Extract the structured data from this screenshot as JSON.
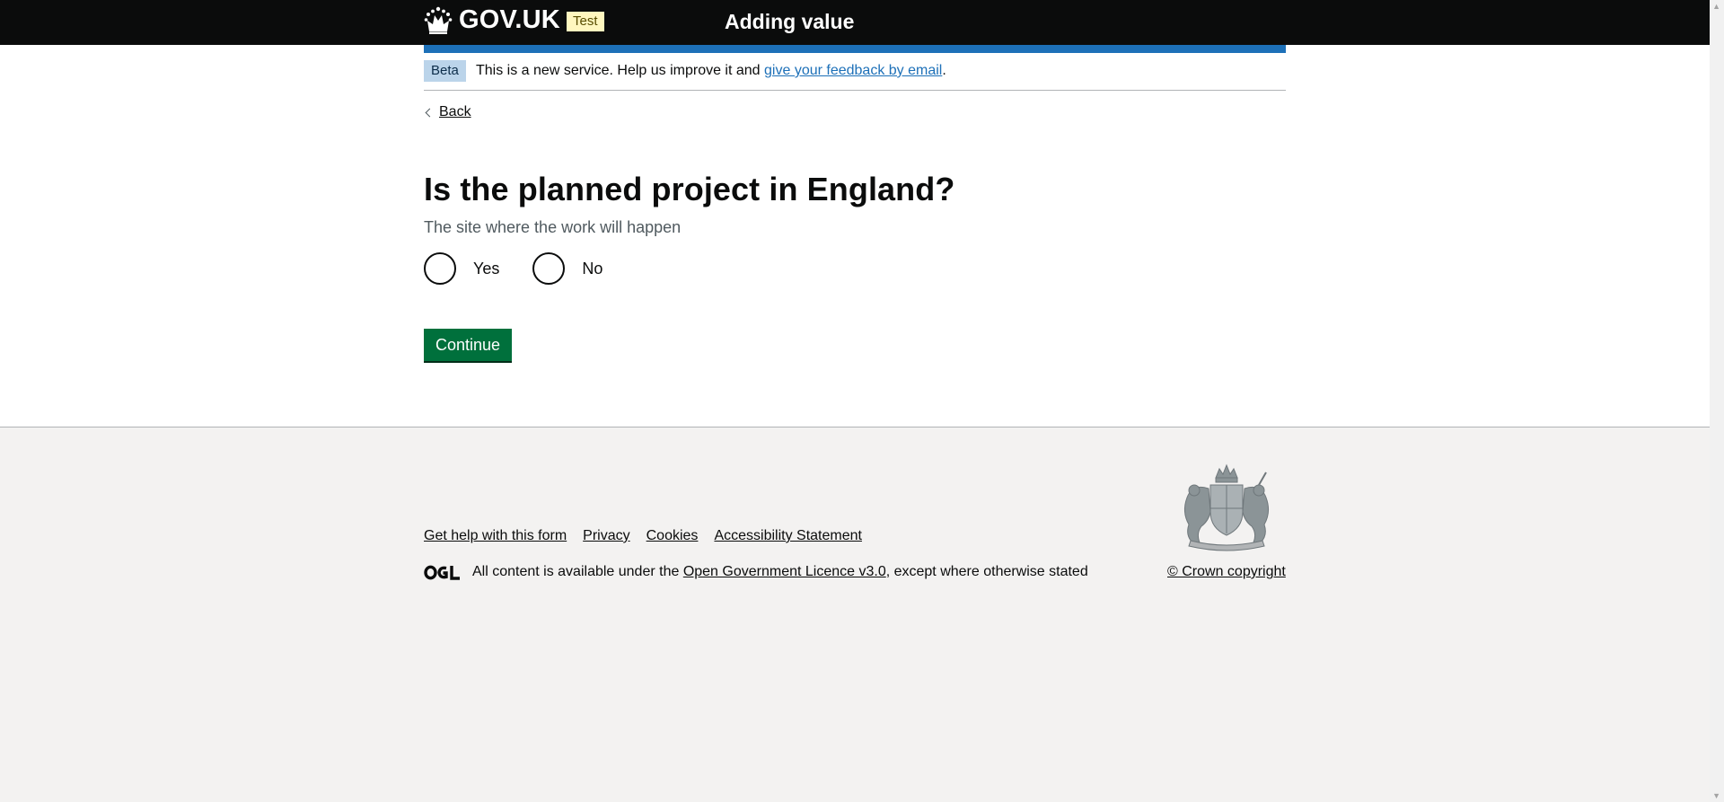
{
  "header": {
    "logo_text": "GOV.UK",
    "env_tag": "Test",
    "service_name": "Adding value"
  },
  "phase_banner": {
    "tag": "Beta",
    "text_before": "This is a new service. Help us improve it and ",
    "link": "give your feedback by email",
    "text_after": "."
  },
  "back_link": "Back",
  "question": {
    "title": "Is the planned project in England?",
    "hint": "The site where the work will happen",
    "options": [
      "Yes",
      "No"
    ]
  },
  "continue_label": "Continue",
  "footer": {
    "links": [
      "Get help with this form",
      "Privacy",
      "Cookies",
      "Accessibility Statement"
    ],
    "licence_before": "All content is available under the ",
    "licence_link": "Open Government Licence v3.0",
    "licence_after": ", except where otherwise stated",
    "copyright": "© Crown copyright"
  },
  "colors": {
    "header": "#0b0c0c",
    "blue_bar": "#1d70b8",
    "button": "#00703c",
    "footer_bg": "#f3f2f1"
  },
  "icons": [
    "crown-icon",
    "chevron-left-icon",
    "ogl-logo",
    "royal-coat-of-arms"
  ]
}
